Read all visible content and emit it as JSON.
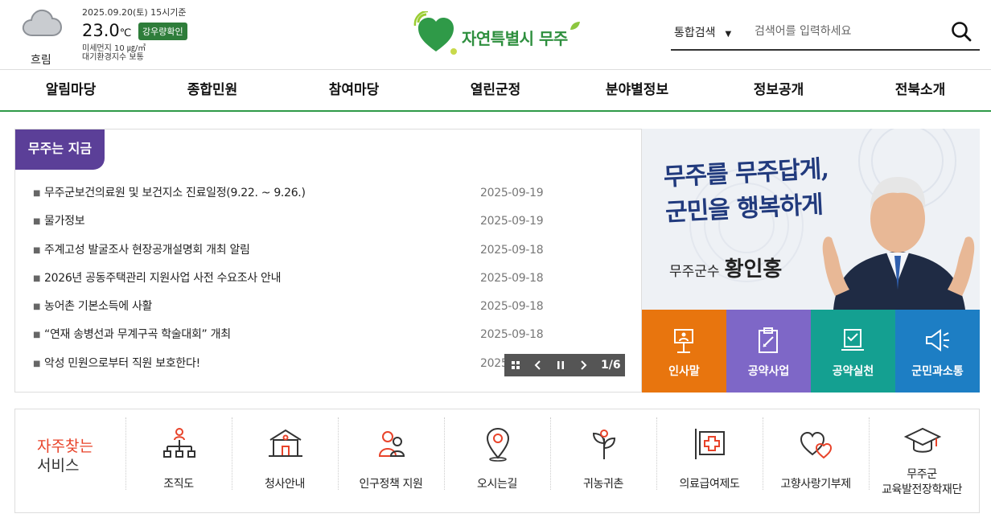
{
  "weather": {
    "condition": "흐림",
    "date": "2025.09.20(토) 15시기준",
    "temp": "23.0",
    "temp_unit": "℃",
    "rain_badge": "강우량확인",
    "dust_line1": "미세먼지 10 ㎍/㎥",
    "dust_line2": "대기환경지수 보통",
    "icon": "cloud-icon"
  },
  "logo": {
    "text": "자연특별시 무주"
  },
  "search": {
    "select_label": "통합검색",
    "placeholder": "검색어를 입력하세요"
  },
  "nav": {
    "items": [
      "알림마당",
      "종합민원",
      "참여마당",
      "열린군정",
      "분야별정보",
      "정보공개",
      "전북소개"
    ]
  },
  "news": {
    "tab_label": "무주는 지금",
    "items": [
      {
        "title": "무주군보건의료원 및 보건지소 진료일정(9.22. ~ 9.26.)",
        "date": "2025-09-19"
      },
      {
        "title": "물가정보",
        "date": "2025-09-19"
      },
      {
        "title": "주계고성 발굴조사 현장공개설명회 개최 알림",
        "date": "2025-09-18"
      },
      {
        "title": "2026년 공동주택관리 지원사업 사전 수요조사 안내",
        "date": "2025-09-18"
      },
      {
        "title": "농어촌 기본소득에 사활",
        "date": "2025-09-18"
      },
      {
        "title": "“연재 송병선과 무계구곡 학술대회” 개최",
        "date": "2025-09-18"
      },
      {
        "title": "악성 민원으로부터 직원 보호한다!",
        "date": "2025-09-18"
      }
    ],
    "page_indicator": "1/6"
  },
  "banner": {
    "slogan_line1": "무주를 무주답게,",
    "slogan_line2": "군민을 행복하게",
    "title_prefix": "무주군수",
    "name": "황인홍"
  },
  "quick4": {
    "items": [
      {
        "label": "인사말",
        "color": "#e8750e",
        "icon": "podium-icon"
      },
      {
        "label": "공약사업",
        "color": "#7e67c7",
        "icon": "clipboard-icon"
      },
      {
        "label": "공약실천",
        "color": "#14a091",
        "icon": "certificate-icon"
      },
      {
        "label": "군민과소통",
        "color": "#1d7ec4",
        "icon": "megaphone-icon"
      }
    ]
  },
  "services": {
    "title_line1": "자주찾는",
    "title_line2": "서비스",
    "items": [
      {
        "label": "조직도",
        "icon": "org-chart-icon"
      },
      {
        "label": "청사안내",
        "icon": "building-icon"
      },
      {
        "label": "인구정책 지원",
        "icon": "family-icon"
      },
      {
        "label": "오시는길",
        "icon": "map-pin-icon"
      },
      {
        "label": "귀농귀촌",
        "icon": "sprout-icon"
      },
      {
        "label": "의료급여제도",
        "icon": "medical-cross-icon"
      },
      {
        "label": "고향사랑기부제",
        "icon": "hearts-icon"
      },
      {
        "label_line1": "무주군",
        "label_line2": "교육발전장학재단",
        "icon": "graduation-cap-icon"
      }
    ]
  },
  "colors": {
    "nav_underline": "#2f9a48",
    "news_tab": "#5b3f98",
    "accent_red": "#e8432a",
    "logo_green": "#2e8f3e"
  }
}
